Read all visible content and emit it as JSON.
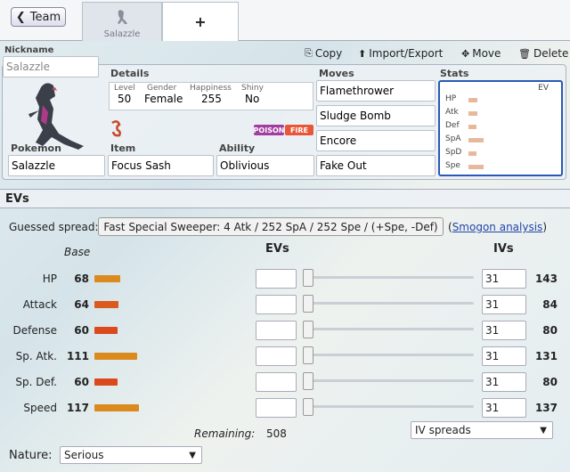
{
  "tabs": {
    "team_label": "Team",
    "current_tab_name": "Salazzle",
    "add_label": "+"
  },
  "toolbar": {
    "copy": "Copy",
    "import_export": "Import/Export",
    "move": "Move",
    "delete": "Delete"
  },
  "set": {
    "nickname_label": "Nickname",
    "nickname_value": "Salazzle",
    "details_label": "Details",
    "level_label": "Level",
    "level": "50",
    "gender_label": "Gender",
    "gender": "Female",
    "happiness_label": "Happiness",
    "happiness": "255",
    "shiny_label": "Shiny",
    "shiny": "No",
    "types": [
      {
        "name": "POISON",
        "color": "#a33ea1"
      },
      {
        "name": "FIRE",
        "color": "#e8563a"
      }
    ],
    "pokemon_label": "Pokemon",
    "pokemon": "Salazzle",
    "item_label": "Item",
    "item": "Focus Sash",
    "ability_label": "Ability",
    "ability": "Oblivious",
    "moves_label": "Moves",
    "moves": [
      "Flamethrower",
      "Sludge Bomb",
      "Encore",
      "Fake Out"
    ],
    "stats_label": "Stats",
    "stats_ev_label": "EV",
    "mini_stats": [
      {
        "name": "HP",
        "fraction": 0.27
      },
      {
        "name": "Atk",
        "fraction": 0.25
      },
      {
        "name": "Def",
        "fraction": 0.23
      },
      {
        "name": "SpA",
        "fraction": 0.44
      },
      {
        "name": "SpD",
        "fraction": 0.23
      },
      {
        "name": "Spe",
        "fraction": 0.46
      }
    ]
  },
  "evs": {
    "heading": "EVs",
    "guessed_label": "Guessed spread:",
    "guessed_spread": "Fast Special Sweeper: 4 Atk / 252 SpA / 252 Spe / (+Spe, -Def)",
    "smogon_link": "Smogon analysis",
    "col_base": "Base",
    "col_evs": "EVs",
    "col_ivs": "IVs",
    "stats": [
      {
        "name": "HP",
        "base": 68,
        "ev": "",
        "iv": "31",
        "total": 143,
        "color": "#db8a1d",
        "bar_fraction": 0.27
      },
      {
        "name": "Attack",
        "base": 64,
        "ev": "",
        "iv": "31",
        "total": 84,
        "color": "#db5a1d",
        "bar_fraction": 0.25
      },
      {
        "name": "Defense",
        "base": 60,
        "ev": "",
        "iv": "31",
        "total": 80,
        "color": "#db4a1d",
        "bar_fraction": 0.24
      },
      {
        "name": "Sp. Atk.",
        "base": 111,
        "ev": "",
        "iv": "31",
        "total": 131,
        "color": "#db8a1d",
        "bar_fraction": 0.44
      },
      {
        "name": "Sp. Def.",
        "base": 60,
        "ev": "",
        "iv": "31",
        "total": 80,
        "color": "#db4a1d",
        "bar_fraction": 0.24
      },
      {
        "name": "Speed",
        "base": 117,
        "ev": "",
        "iv": "31",
        "total": 137,
        "color": "#db8a1d",
        "bar_fraction": 0.46
      }
    ],
    "remaining_label": "Remaining:",
    "remaining_value": "508",
    "iv_spreads": "IV spreads",
    "nature_label": "Nature:",
    "nature": "Serious"
  }
}
